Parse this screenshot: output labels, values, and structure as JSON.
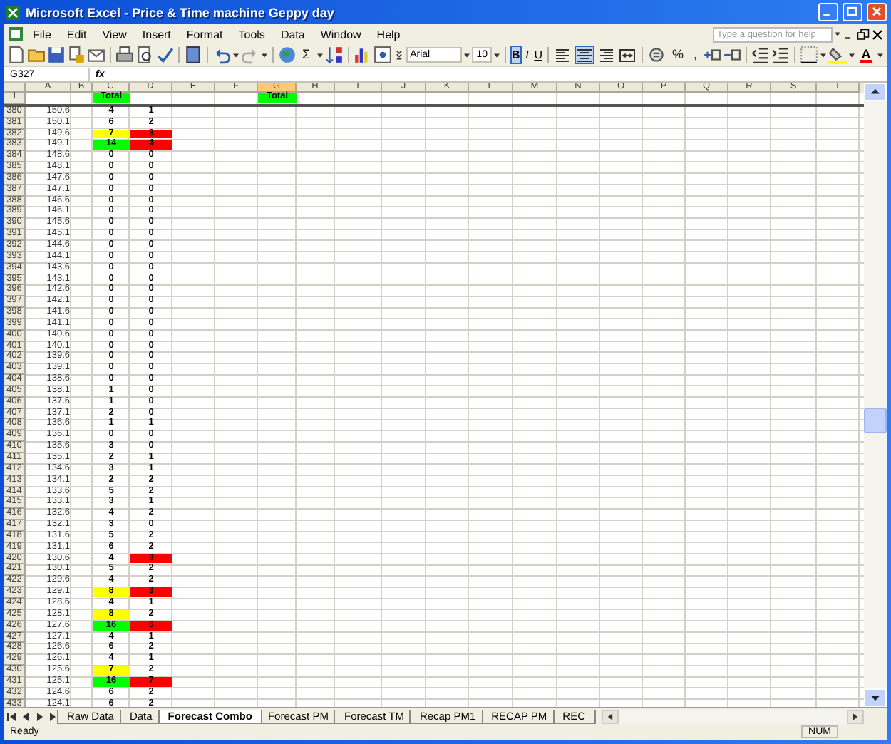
{
  "window": {
    "title": "Microsoft Excel - Price & Time machine Geppy day"
  },
  "menu": [
    "File",
    "Edit",
    "View",
    "Insert",
    "Format",
    "Tools",
    "Data",
    "Window",
    "Help"
  ],
  "help_box": {
    "placeholder": "Type a question for help"
  },
  "toolbar": {
    "autosum": "Σ",
    "font": "Arial",
    "font_size": "10",
    "styles": [
      {
        "label": "B",
        "selected": true
      },
      {
        "label": "I",
        "selected": false
      },
      {
        "label": "U",
        "selected": false
      }
    ],
    "alignment": [
      {
        "selected": false
      },
      {
        "selected": true
      },
      {
        "selected": false
      },
      {
        "selected": false
      }
    ],
    "percent": "%",
    "comma": ",",
    "font_color": "A"
  },
  "formula_bar": {
    "name_box": "G327",
    "fx": "fx"
  },
  "columns": [
    {
      "label": "A",
      "selected": false
    },
    {
      "label": "B",
      "selected": false
    },
    {
      "label": "C",
      "selected": false
    },
    {
      "label": "D",
      "selected": false
    },
    {
      "label": "E",
      "selected": false
    },
    {
      "label": "F",
      "selected": false
    },
    {
      "label": "G",
      "selected": true
    },
    {
      "label": "H",
      "selected": false
    },
    {
      "label": "I",
      "selected": false
    },
    {
      "label": "J",
      "selected": false
    },
    {
      "label": "K",
      "selected": false
    },
    {
      "label": "L",
      "selected": false
    },
    {
      "label": "M",
      "selected": false
    },
    {
      "label": "N",
      "selected": false
    },
    {
      "label": "O",
      "selected": false
    },
    {
      "label": "P",
      "selected": false
    },
    {
      "label": "Q",
      "selected": false
    },
    {
      "label": "R",
      "selected": false
    },
    {
      "label": "S",
      "selected": false
    },
    {
      "label": "T",
      "selected": false
    }
  ],
  "header_row": {
    "number": "1",
    "c": {
      "text": "Total",
      "color": "#00ff00"
    },
    "g": {
      "text": "Total",
      "color": "#00ff00"
    }
  },
  "rows": [
    {
      "number": "380",
      "a": "150.6",
      "c": {
        "text": "4"
      },
      "d": {
        "text": "1"
      }
    },
    {
      "number": "381",
      "a": "150.1",
      "c": {
        "text": "6"
      },
      "d": {
        "text": "2"
      }
    },
    {
      "number": "382",
      "a": "149.6",
      "c": {
        "text": "7",
        "color": "#ffff00"
      },
      "d": {
        "text": "3",
        "color": "#ff0000"
      }
    },
    {
      "number": "383",
      "a": "149.1",
      "c": {
        "text": "14",
        "color": "#00ff00"
      },
      "d": {
        "text": "4",
        "color": "#ff0000"
      }
    },
    {
      "number": "384",
      "a": "148.6",
      "c": {
        "text": "0"
      },
      "d": {
        "text": "0"
      }
    },
    {
      "number": "385",
      "a": "148.1",
      "c": {
        "text": "0"
      },
      "d": {
        "text": "0"
      }
    },
    {
      "number": "386",
      "a": "147.6",
      "c": {
        "text": "0"
      },
      "d": {
        "text": "0"
      }
    },
    {
      "number": "387",
      "a": "147.1",
      "c": {
        "text": "0"
      },
      "d": {
        "text": "0"
      }
    },
    {
      "number": "388",
      "a": "146.6",
      "c": {
        "text": "0"
      },
      "d": {
        "text": "0"
      }
    },
    {
      "number": "389",
      "a": "146.1",
      "c": {
        "text": "0"
      },
      "d": {
        "text": "0"
      }
    },
    {
      "number": "390",
      "a": "145.6",
      "c": {
        "text": "0"
      },
      "d": {
        "text": "0"
      }
    },
    {
      "number": "391",
      "a": "145.1",
      "c": {
        "text": "0"
      },
      "d": {
        "text": "0"
      }
    },
    {
      "number": "392",
      "a": "144.6",
      "c": {
        "text": "0"
      },
      "d": {
        "text": "0"
      }
    },
    {
      "number": "393",
      "a": "144.1",
      "c": {
        "text": "0"
      },
      "d": {
        "text": "0"
      }
    },
    {
      "number": "394",
      "a": "143.6",
      "c": {
        "text": "0"
      },
      "d": {
        "text": "0"
      }
    },
    {
      "number": "395",
      "a": "143.1",
      "c": {
        "text": "0"
      },
      "d": {
        "text": "0"
      }
    },
    {
      "number": "396",
      "a": "142.6",
      "c": {
        "text": "0"
      },
      "d": {
        "text": "0"
      }
    },
    {
      "number": "397",
      "a": "142.1",
      "c": {
        "text": "0"
      },
      "d": {
        "text": "0"
      }
    },
    {
      "number": "398",
      "a": "141.6",
      "c": {
        "text": "0"
      },
      "d": {
        "text": "0"
      }
    },
    {
      "number": "399",
      "a": "141.1",
      "c": {
        "text": "0"
      },
      "d": {
        "text": "0"
      }
    },
    {
      "number": "400",
      "a": "140.6",
      "c": {
        "text": "0"
      },
      "d": {
        "text": "0"
      }
    },
    {
      "number": "401",
      "a": "140.1",
      "c": {
        "text": "0"
      },
      "d": {
        "text": "0"
      }
    },
    {
      "number": "402",
      "a": "139.6",
      "c": {
        "text": "0"
      },
      "d": {
        "text": "0"
      }
    },
    {
      "number": "403",
      "a": "139.1",
      "c": {
        "text": "0"
      },
      "d": {
        "text": "0"
      }
    },
    {
      "number": "404",
      "a": "138.6",
      "c": {
        "text": "0"
      },
      "d": {
        "text": "0"
      }
    },
    {
      "number": "405",
      "a": "138.1",
      "c": {
        "text": "1"
      },
      "d": {
        "text": "0"
      }
    },
    {
      "number": "406",
      "a": "137.6",
      "c": {
        "text": "1"
      },
      "d": {
        "text": "0"
      }
    },
    {
      "number": "407",
      "a": "137.1",
      "c": {
        "text": "2"
      },
      "d": {
        "text": "0"
      }
    },
    {
      "number": "408",
      "a": "136.6",
      "c": {
        "text": "1"
      },
      "d": {
        "text": "1"
      }
    },
    {
      "number": "409",
      "a": "136.1",
      "c": {
        "text": "0"
      },
      "d": {
        "text": "0"
      }
    },
    {
      "number": "410",
      "a": "135.6",
      "c": {
        "text": "3"
      },
      "d": {
        "text": "0"
      }
    },
    {
      "number": "411",
      "a": "135.1",
      "c": {
        "text": "2"
      },
      "d": {
        "text": "1"
      }
    },
    {
      "number": "412",
      "a": "134.6",
      "c": {
        "text": "3"
      },
      "d": {
        "text": "1"
      }
    },
    {
      "number": "413",
      "a": "134.1",
      "c": {
        "text": "2"
      },
      "d": {
        "text": "2"
      }
    },
    {
      "number": "414",
      "a": "133.6",
      "c": {
        "text": "5"
      },
      "d": {
        "text": "2"
      }
    },
    {
      "number": "415",
      "a": "133.1",
      "c": {
        "text": "3"
      },
      "d": {
        "text": "1"
      }
    },
    {
      "number": "416",
      "a": "132.6",
      "c": {
        "text": "4"
      },
      "d": {
        "text": "2"
      }
    },
    {
      "number": "417",
      "a": "132.1",
      "c": {
        "text": "3"
      },
      "d": {
        "text": "0"
      }
    },
    {
      "number": "418",
      "a": "131.6",
      "c": {
        "text": "5"
      },
      "d": {
        "text": "2"
      }
    },
    {
      "number": "419",
      "a": "131.1",
      "c": {
        "text": "6"
      },
      "d": {
        "text": "2"
      }
    },
    {
      "number": "420",
      "a": "130.6",
      "c": {
        "text": "4"
      },
      "d": {
        "text": "3",
        "color": "#ff0000"
      }
    },
    {
      "number": "421",
      "a": "130.1",
      "c": {
        "text": "5"
      },
      "d": {
        "text": "2"
      }
    },
    {
      "number": "422",
      "a": "129.6",
      "c": {
        "text": "4"
      },
      "d": {
        "text": "2"
      }
    },
    {
      "number": "423",
      "a": "129.1",
      "c": {
        "text": "8",
        "color": "#ffff00"
      },
      "d": {
        "text": "3",
        "color": "#ff0000"
      }
    },
    {
      "number": "424",
      "a": "128.6",
      "c": {
        "text": "4"
      },
      "d": {
        "text": "1"
      }
    },
    {
      "number": "425",
      "a": "128.1",
      "c": {
        "text": "8",
        "color": "#ffff00"
      },
      "d": {
        "text": "2"
      }
    },
    {
      "number": "426",
      "a": "127.6",
      "c": {
        "text": "16",
        "color": "#00ff00"
      },
      "d": {
        "text": "6",
        "color": "#ff0000"
      }
    },
    {
      "number": "427",
      "a": "127.1",
      "c": {
        "text": "4"
      },
      "d": {
        "text": "1"
      }
    },
    {
      "number": "428",
      "a": "126.6",
      "c": {
        "text": "6"
      },
      "d": {
        "text": "2"
      }
    },
    {
      "number": "429",
      "a": "126.1",
      "c": {
        "text": "4"
      },
      "d": {
        "text": "1"
      }
    },
    {
      "number": "430",
      "a": "125.6",
      "c": {
        "text": "7",
        "color": "#ffff00"
      },
      "d": {
        "text": "2"
      }
    },
    {
      "number": "431",
      "a": "125.1",
      "c": {
        "text": "16",
        "color": "#00ff00"
      },
      "d": {
        "text": "7",
        "color": "#ff0000"
      }
    },
    {
      "number": "432",
      "a": "124.6",
      "c": {
        "text": "6"
      },
      "d": {
        "text": "2"
      }
    },
    {
      "number": "433",
      "a": "124.1",
      "c": {
        "text": "6"
      },
      "d": {
        "text": "2"
      }
    }
  ],
  "sheet_tabs": [
    {
      "label": "Raw Data",
      "selected": false
    },
    {
      "label": "Data",
      "selected": false
    },
    {
      "label": "Forecast Combo",
      "selected": true
    },
    {
      "label": "Forecast PM",
      "selected": false
    },
    {
      "label": "Forecast TM",
      "selected": false
    },
    {
      "label": "Recap PM1",
      "selected": false
    },
    {
      "label": "RECAP PM",
      "selected": false
    },
    {
      "label": "REC",
      "selected": false
    }
  ],
  "status_bar": {
    "message": "Ready",
    "num_lock": "NUM"
  }
}
